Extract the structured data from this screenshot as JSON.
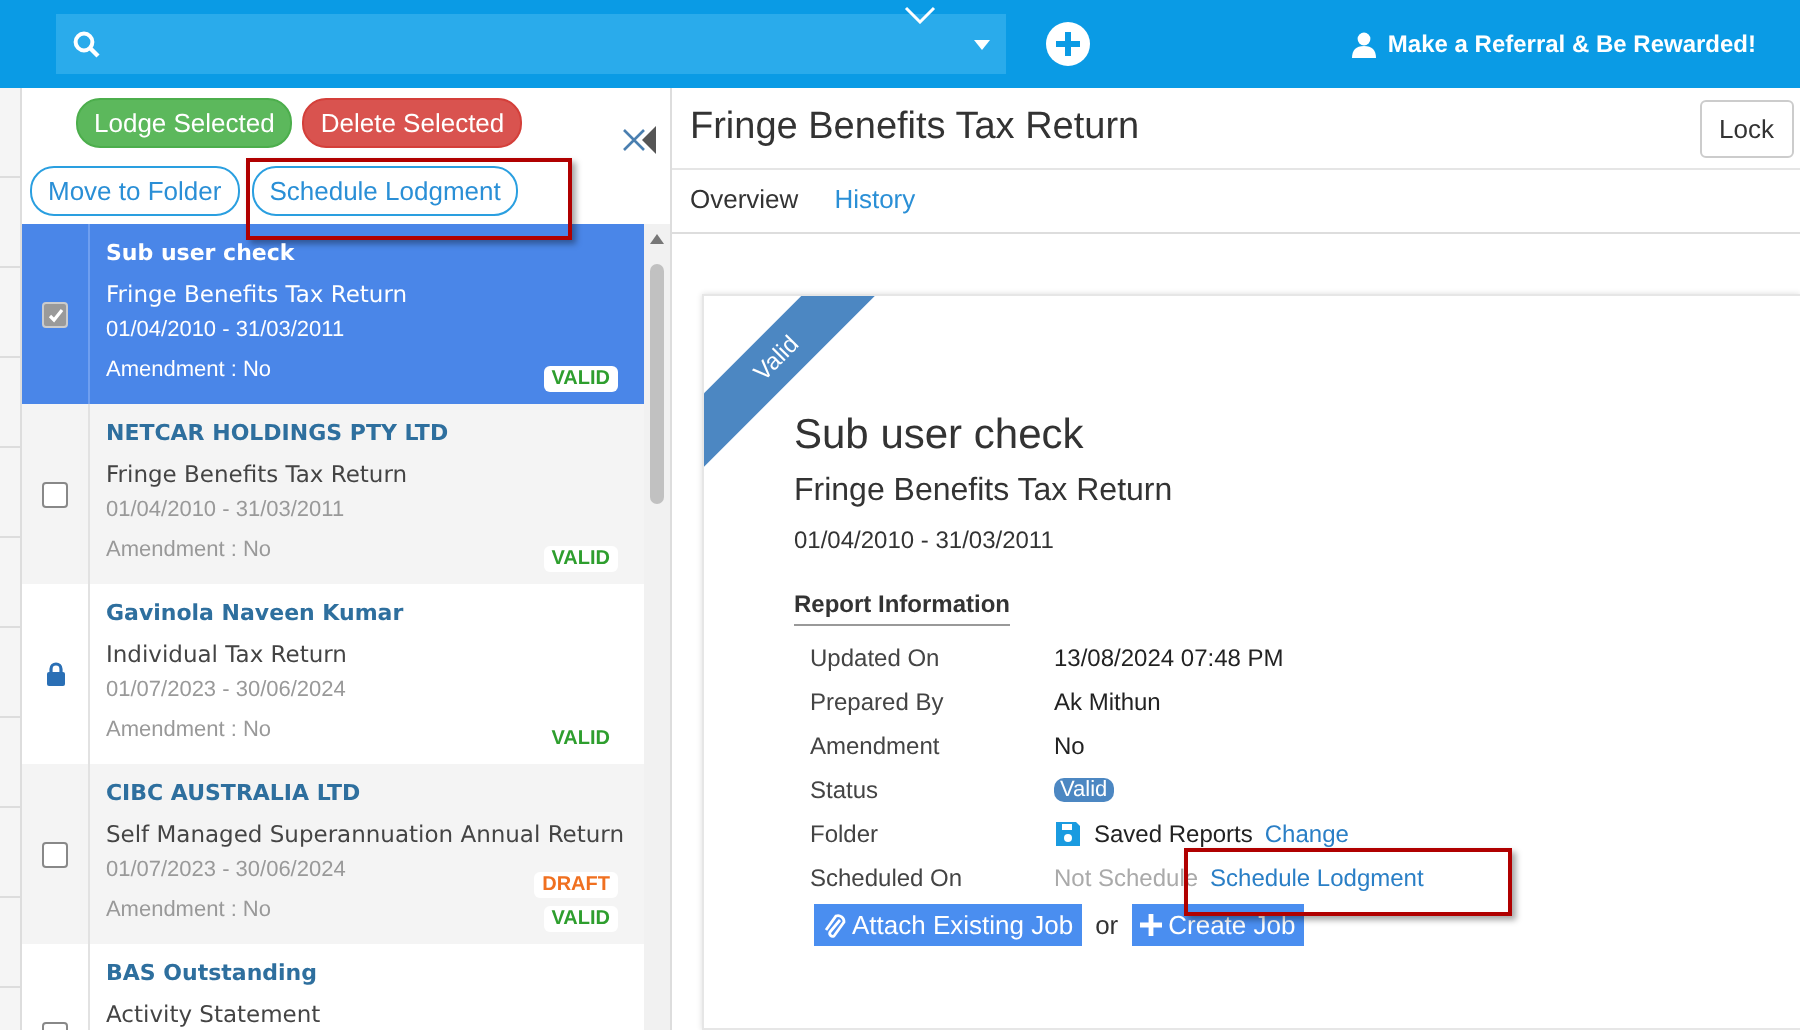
{
  "topbar": {
    "referral": "Make a Referral & Be Rewarded!"
  },
  "toolbar": {
    "buttons": [
      {
        "label": "Lodge Selected",
        "kind": "success"
      },
      {
        "label": "Delete Selected",
        "kind": "danger"
      },
      {
        "label": "Move to Folder",
        "kind": "outline"
      },
      {
        "label": "Schedule Lodgment",
        "kind": "outline",
        "highlighted": true
      }
    ]
  },
  "returns": [
    {
      "name": "Sub user check",
      "type": "Fringe Benefits Tax Return",
      "period": "01/04/2010 - 31/03/2011",
      "amendment": "Amendment : No",
      "kind": "checkbox",
      "checked": true,
      "selected": true,
      "badges": [
        {
          "label": "VALID",
          "kind": "valid"
        }
      ]
    },
    {
      "name": "NETCAR HOLDINGS PTY LTD",
      "type": "Fringe Benefits Tax Return",
      "period": "01/04/2010 - 31/03/2011",
      "amendment": "Amendment : No",
      "kind": "checkbox",
      "checked": false,
      "selected": false,
      "badges": [
        {
          "label": "VALID",
          "kind": "valid"
        }
      ]
    },
    {
      "name": "Gavinola Naveen Kumar",
      "type": "Individual Tax Return",
      "period": "01/07/2023 - 30/06/2024",
      "amendment": "Amendment : No",
      "kind": "lock",
      "selected": false,
      "badges": [
        {
          "label": "VALID",
          "kind": "valid"
        }
      ]
    },
    {
      "name": "CIBC AUSTRALIA LTD",
      "type": "Self Managed Superannuation Annual Return",
      "period": "01/07/2023 - 30/06/2024",
      "amendment": "Amendment : No",
      "kind": "checkbox",
      "checked": false,
      "selected": false,
      "badges": [
        {
          "label": "DRAFT",
          "kind": "draft"
        },
        {
          "label": "VALID",
          "kind": "valid"
        }
      ]
    },
    {
      "name": "BAS Outstanding",
      "type": "Activity Statement",
      "kind": "checkbox",
      "checked": false,
      "selected": false
    }
  ],
  "detail": {
    "title": "Fringe Benefits Tax Return",
    "lock": "Lock",
    "tabs": [
      {
        "label": "Overview",
        "selected": true
      },
      {
        "label": "History",
        "selected": false
      }
    ],
    "ribbon": "Valid",
    "name": "Sub user check",
    "type": "Fringe Benefits Tax Return",
    "period": "01/04/2010 - 31/03/2011",
    "section": "Report Information",
    "fields": [
      {
        "label": "Updated On",
        "kind": "text",
        "value": "13/08/2024 07:48 PM"
      },
      {
        "label": "Prepared By",
        "kind": "text",
        "value": "Ak Mithun"
      },
      {
        "label": "Amendment",
        "kind": "text",
        "value": "No"
      },
      {
        "label": "Status",
        "kind": "badge",
        "value": "Valid"
      },
      {
        "label": "Folder",
        "kind": "folder",
        "value": "Saved Reports",
        "link": "Change"
      },
      {
        "label": "Scheduled On",
        "kind": "schedule",
        "value": "Not Schedule",
        "link": "Schedule Lodgment",
        "highlighted": true
      }
    ],
    "actions": [
      {
        "label": "Attach Existing Job",
        "kind": "attach"
      },
      {
        "label": "Create Job",
        "kind": "create"
      }
    ],
    "separator": "or"
  }
}
